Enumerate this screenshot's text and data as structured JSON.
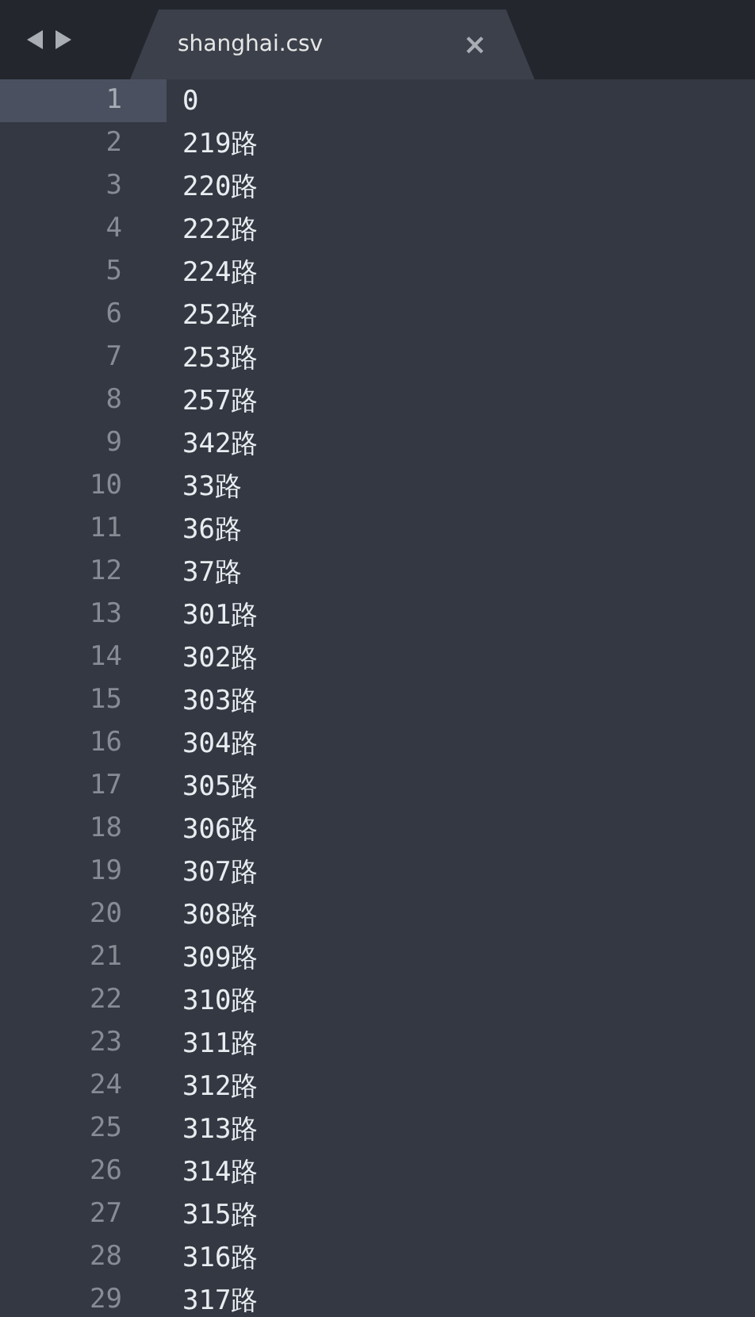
{
  "tab": {
    "title": "shanghai.csv",
    "close": "×",
    "selected": true
  },
  "lines": [
    {
      "number": "1",
      "text": "0",
      "current": true
    },
    {
      "number": "2",
      "text": "219路",
      "current": false
    },
    {
      "number": "3",
      "text": "220路",
      "current": false
    },
    {
      "number": "4",
      "text": "222路",
      "current": false
    },
    {
      "number": "5",
      "text": "224路",
      "current": false
    },
    {
      "number": "6",
      "text": "252路",
      "current": false
    },
    {
      "number": "7",
      "text": "253路",
      "current": false
    },
    {
      "number": "8",
      "text": "257路",
      "current": false
    },
    {
      "number": "9",
      "text": "342路",
      "current": false
    },
    {
      "number": "10",
      "text": "33路",
      "current": false
    },
    {
      "number": "11",
      "text": "36路",
      "current": false
    },
    {
      "number": "12",
      "text": "37路",
      "current": false
    },
    {
      "number": "13",
      "text": "301路",
      "current": false
    },
    {
      "number": "14",
      "text": "302路",
      "current": false
    },
    {
      "number": "15",
      "text": "303路",
      "current": false
    },
    {
      "number": "16",
      "text": "304路",
      "current": false
    },
    {
      "number": "17",
      "text": "305路",
      "current": false
    },
    {
      "number": "18",
      "text": "306路",
      "current": false
    },
    {
      "number": "19",
      "text": "307路",
      "current": false
    },
    {
      "number": "20",
      "text": "308路",
      "current": false
    },
    {
      "number": "21",
      "text": "309路",
      "current": false
    },
    {
      "number": "22",
      "text": "310路",
      "current": false
    },
    {
      "number": "23",
      "text": "311路",
      "current": false
    },
    {
      "number": "24",
      "text": "312路",
      "current": false
    },
    {
      "number": "25",
      "text": "313路",
      "current": false
    },
    {
      "number": "26",
      "text": "314路",
      "current": false
    },
    {
      "number": "27",
      "text": "315路",
      "current": false
    },
    {
      "number": "28",
      "text": "316路",
      "current": false
    },
    {
      "number": "29",
      "text": "317路",
      "current": false
    }
  ]
}
